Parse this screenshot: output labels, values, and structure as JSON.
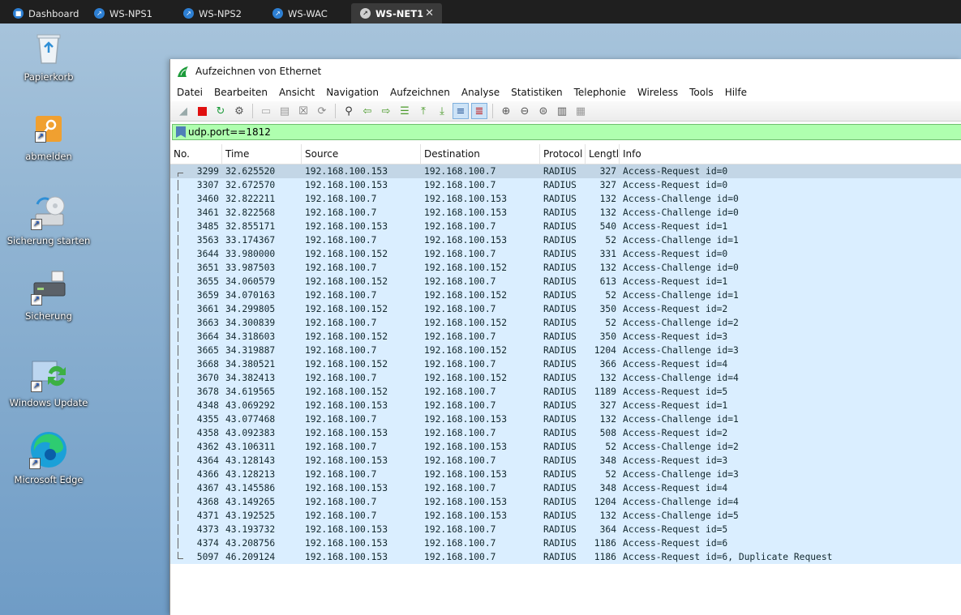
{
  "tabs": [
    {
      "label": "Dashboard"
    },
    {
      "label": "WS-NPS1"
    },
    {
      "label": "WS-NPS2"
    },
    {
      "label": "WS-WAC"
    },
    {
      "label": "WS-NET1",
      "close": "✕"
    }
  ],
  "desktop_icons": [
    {
      "label": "Papierkorb",
      "icon": "recycle-bin-icon"
    },
    {
      "label": "abmelden",
      "icon": "key-icon"
    },
    {
      "label": "Sicherung starten",
      "icon": "backup-start-icon"
    },
    {
      "label": "Sicherung",
      "icon": "backup-drive-icon"
    },
    {
      "label": "Windows Update",
      "icon": "windows-update-icon"
    },
    {
      "label": "Microsoft Edge",
      "icon": "edge-icon"
    }
  ],
  "window": {
    "title": "Aufzeichnen von Ethernet"
  },
  "menu": [
    "Datei",
    "Bearbeiten",
    "Ansicht",
    "Navigation",
    "Aufzeichnen",
    "Analyse",
    "Statistiken",
    "Telephonie",
    "Wireless",
    "Tools",
    "Hilfe"
  ],
  "toolbar_icons": [
    "start-capture-icon",
    "stop-capture-icon",
    "restart-capture-icon",
    "capture-options-icon",
    "open-file-icon",
    "save-file-icon",
    "close-file-icon",
    "reload-icon",
    "find-packet-icon",
    "back-icon",
    "forward-icon",
    "go-to-packet-icon",
    "first-packet-icon",
    "last-packet-icon",
    "autoscroll-icon",
    "colorize-icon",
    "zoom-in-icon",
    "zoom-out-icon",
    "zoom-normal-icon",
    "resize-columns-icon",
    "layout-icon"
  ],
  "filter": {
    "value": "udp.port==1812"
  },
  "columns": [
    "No.",
    "Time",
    "Source",
    "Destination",
    "Protocol",
    "Lengtl",
    "Info"
  ],
  "rows": [
    [
      "3299",
      "32.625520",
      "192.168.100.153",
      "192.168.100.7",
      "RADIUS",
      "327",
      "Access-Request id=0"
    ],
    [
      "3307",
      "32.672570",
      "192.168.100.153",
      "192.168.100.7",
      "RADIUS",
      "327",
      "Access-Request id=0"
    ],
    [
      "3460",
      "32.822211",
      "192.168.100.7",
      "192.168.100.153",
      "RADIUS",
      "132",
      "Access-Challenge id=0"
    ],
    [
      "3461",
      "32.822568",
      "192.168.100.7",
      "192.168.100.153",
      "RADIUS",
      "132",
      "Access-Challenge id=0"
    ],
    [
      "3485",
      "32.855171",
      "192.168.100.153",
      "192.168.100.7",
      "RADIUS",
      "540",
      "Access-Request id=1"
    ],
    [
      "3563",
      "33.174367",
      "192.168.100.7",
      "192.168.100.153",
      "RADIUS",
      "52",
      "Access-Challenge id=1"
    ],
    [
      "3644",
      "33.980000",
      "192.168.100.152",
      "192.168.100.7",
      "RADIUS",
      "331",
      "Access-Request id=0"
    ],
    [
      "3651",
      "33.987503",
      "192.168.100.7",
      "192.168.100.152",
      "RADIUS",
      "132",
      "Access-Challenge id=0"
    ],
    [
      "3655",
      "34.060579",
      "192.168.100.152",
      "192.168.100.7",
      "RADIUS",
      "613",
      "Access-Request id=1"
    ],
    [
      "3659",
      "34.070163",
      "192.168.100.7",
      "192.168.100.152",
      "RADIUS",
      "52",
      "Access-Challenge id=1"
    ],
    [
      "3661",
      "34.299805",
      "192.168.100.152",
      "192.168.100.7",
      "RADIUS",
      "350",
      "Access-Request id=2"
    ],
    [
      "3663",
      "34.300839",
      "192.168.100.7",
      "192.168.100.152",
      "RADIUS",
      "52",
      "Access-Challenge id=2"
    ],
    [
      "3664",
      "34.318603",
      "192.168.100.152",
      "192.168.100.7",
      "RADIUS",
      "350",
      "Access-Request id=3"
    ],
    [
      "3665",
      "34.319887",
      "192.168.100.7",
      "192.168.100.152",
      "RADIUS",
      "1204",
      "Access-Challenge id=3"
    ],
    [
      "3668",
      "34.380521",
      "192.168.100.152",
      "192.168.100.7",
      "RADIUS",
      "366",
      "Access-Request id=4"
    ],
    [
      "3670",
      "34.382413",
      "192.168.100.7",
      "192.168.100.152",
      "RADIUS",
      "132",
      "Access-Challenge id=4"
    ],
    [
      "3678",
      "34.619565",
      "192.168.100.152",
      "192.168.100.7",
      "RADIUS",
      "1189",
      "Access-Request id=5"
    ],
    [
      "4348",
      "43.069292",
      "192.168.100.153",
      "192.168.100.7",
      "RADIUS",
      "327",
      "Access-Request id=1"
    ],
    [
      "4355",
      "43.077468",
      "192.168.100.7",
      "192.168.100.153",
      "RADIUS",
      "132",
      "Access-Challenge id=1"
    ],
    [
      "4358",
      "43.092383",
      "192.168.100.153",
      "192.168.100.7",
      "RADIUS",
      "508",
      "Access-Request id=2"
    ],
    [
      "4362",
      "43.106311",
      "192.168.100.7",
      "192.168.100.153",
      "RADIUS",
      "52",
      "Access-Challenge id=2"
    ],
    [
      "4364",
      "43.128143",
      "192.168.100.153",
      "192.168.100.7",
      "RADIUS",
      "348",
      "Access-Request id=3"
    ],
    [
      "4366",
      "43.128213",
      "192.168.100.7",
      "192.168.100.153",
      "RADIUS",
      "52",
      "Access-Challenge id=3"
    ],
    [
      "4367",
      "43.145586",
      "192.168.100.153",
      "192.168.100.7",
      "RADIUS",
      "348",
      "Access-Request id=4"
    ],
    [
      "4368",
      "43.149265",
      "192.168.100.7",
      "192.168.100.153",
      "RADIUS",
      "1204",
      "Access-Challenge id=4"
    ],
    [
      "4371",
      "43.192525",
      "192.168.100.7",
      "192.168.100.153",
      "RADIUS",
      "132",
      "Access-Challenge id=5"
    ],
    [
      "4373",
      "43.193732",
      "192.168.100.153",
      "192.168.100.7",
      "RADIUS",
      "364",
      "Access-Request id=5"
    ],
    [
      "4374",
      "43.208756",
      "192.168.100.153",
      "192.168.100.7",
      "RADIUS",
      "1186",
      "Access-Request id=6"
    ],
    [
      "5097",
      "46.209124",
      "192.168.100.153",
      "192.168.100.7",
      "RADIUS",
      "1186",
      "Access-Request id=6, Duplicate Request"
    ]
  ],
  "colors": {
    "row_bg": "#daeeff",
    "selected_row_bg": "#c3d6e6",
    "filter_ok_bg": "#afffaf",
    "taskbar_bg": "#1f1f1f"
  }
}
